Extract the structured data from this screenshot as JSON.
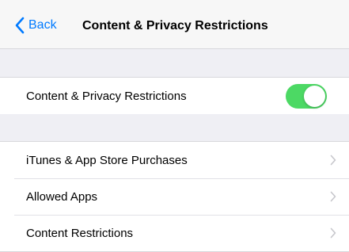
{
  "nav": {
    "back_label": "Back",
    "back_icon": "chevron-left-icon",
    "title": "Content & Privacy Restrictions"
  },
  "restrictions_toggle": {
    "label": "Content & Privacy Restrictions",
    "state": "on"
  },
  "menu": {
    "items": [
      {
        "label": "iTunes & App Store Purchases",
        "icon": "chevron-right-icon"
      },
      {
        "label": "Allowed Apps",
        "icon": "chevron-right-icon"
      },
      {
        "label": "Content Restrictions",
        "icon": "chevron-right-icon"
      }
    ]
  },
  "colors": {
    "accent": "#007aff",
    "toggle_on": "#4cd964",
    "background": "#efeff4",
    "chevron": "#c7c7cc"
  }
}
